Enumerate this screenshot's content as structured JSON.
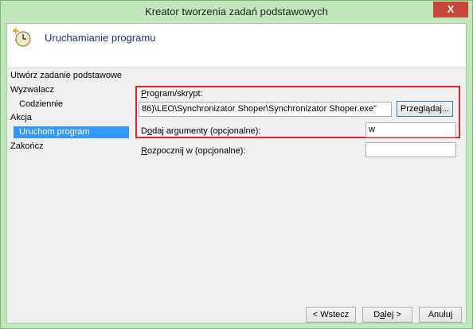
{
  "window": {
    "title": "Kreator tworzenia zadań podstawowych",
    "close_symbol": "X"
  },
  "header": {
    "title": "Uruchamianie programu",
    "icon": "scheduled-task-icon"
  },
  "nav": {
    "items": [
      {
        "label": "Utwórz zadanie podstawowe",
        "level": 0,
        "selected": false
      },
      {
        "label": "Wyzwalacz",
        "level": 0,
        "selected": false
      },
      {
        "label": "Codziennie",
        "level": 1,
        "selected": false
      },
      {
        "label": "Akcja",
        "level": 0,
        "selected": false
      },
      {
        "label": "Uruchom program",
        "level": 1,
        "selected": true
      },
      {
        "label": "Zakończ",
        "level": 0,
        "selected": false
      }
    ]
  },
  "form": {
    "program_label_u": "P",
    "program_label_rest": "rogram/skrypt:",
    "program_value": "86)\\LEO\\Synchronizator Shoper\\Synchronizator Shoper.exe\"",
    "browse_label_u": "e",
    "browse_label_pre": "Przegl",
    "browse_label_mid": "ą",
    "browse_label_post": "daj...",
    "args_label_pre": "D",
    "args_label_u": "o",
    "args_label_rest": "daj argumenty (opcjonalne):",
    "args_value": "w",
    "start_label_u": "R",
    "start_label_rest": "ozpocznij w (opcjonalne):",
    "start_value": ""
  },
  "footer": {
    "back_label": "< Wstecz",
    "next_label_pre": "D",
    "next_label_u": "a",
    "next_label_rest": "lej >",
    "cancel_label": "Anuluj"
  },
  "colors": {
    "highlight": "#d9272e",
    "selection": "#3399ff",
    "title_accent": "#1e3287"
  }
}
